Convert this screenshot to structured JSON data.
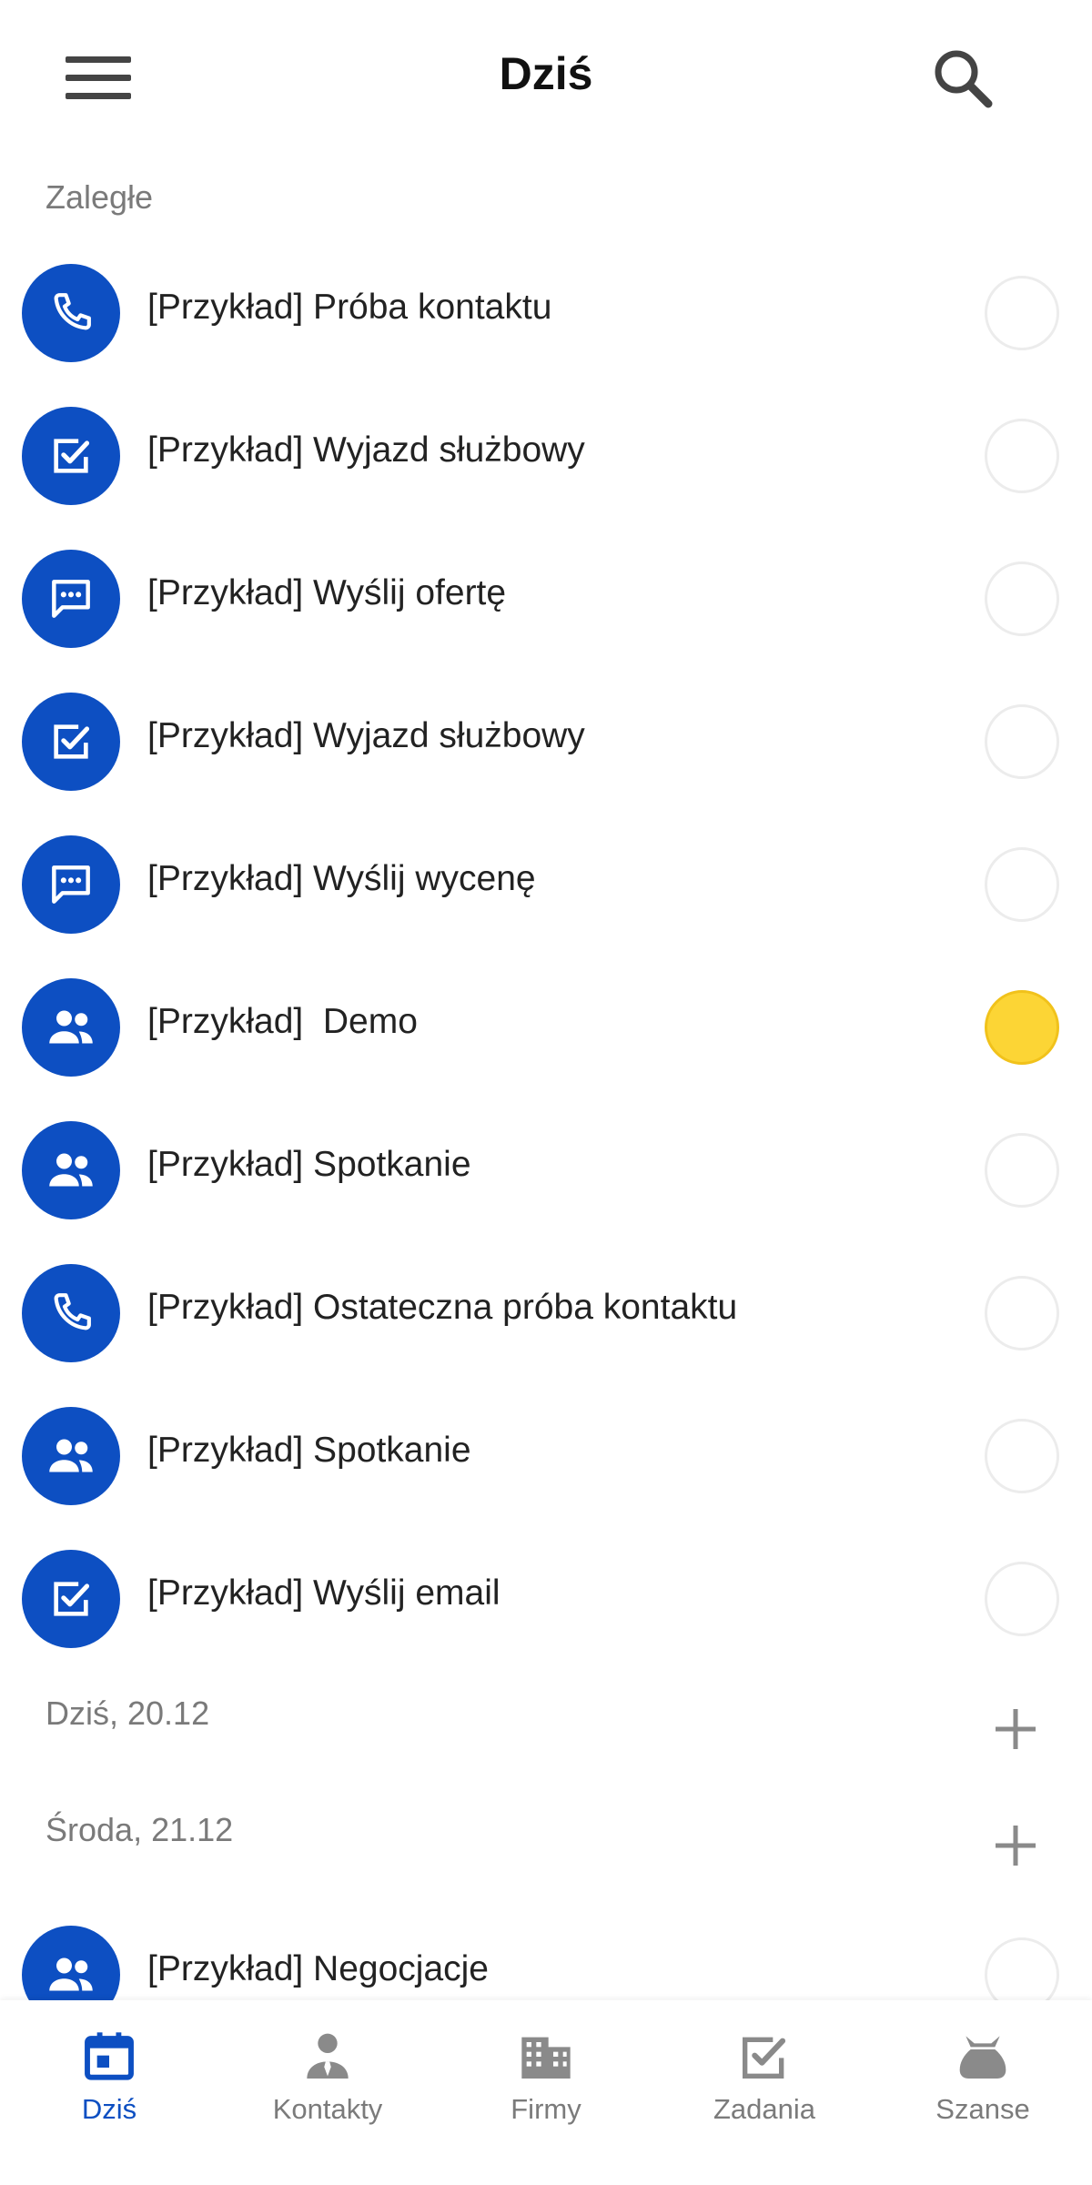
{
  "header": {
    "title": "Dziś"
  },
  "sections": [
    {
      "label": "Zaległe",
      "items": [
        {
          "icon": "phone-icon",
          "text": "[Przykład] Próba kontaktu",
          "done": false
        },
        {
          "icon": "task-check-icon",
          "text": "[Przykład] Wyjazd służbowy",
          "done": false
        },
        {
          "icon": "chat-icon",
          "text": "[Przykład] Wyślij ofertę",
          "done": false
        },
        {
          "icon": "task-check-icon",
          "text": "[Przykład] Wyjazd służbowy",
          "done": false
        },
        {
          "icon": "chat-icon",
          "text": "[Przykład] Wyślij wycenę",
          "done": false
        },
        {
          "icon": "people-icon",
          "text": "[Przykład]  Demo",
          "done": false,
          "highlighted": true
        },
        {
          "icon": "people-icon",
          "text": "[Przykład] Spotkanie",
          "done": false
        },
        {
          "icon": "phone-icon",
          "text": "[Przykład] Ostateczna próba kontaktu",
          "done": false
        },
        {
          "icon": "people-icon",
          "text": "[Przykład] Spotkanie",
          "done": false
        },
        {
          "icon": "task-check-icon",
          "text": "[Przykład] Wyślij email",
          "done": false
        }
      ]
    },
    {
      "label": "Dziś, 20.12",
      "add_icon": "plus-icon",
      "items": []
    },
    {
      "label": "Środa, 21.12",
      "add_icon": "plus-icon",
      "items": [
        {
          "icon": "people-icon",
          "text": "[Przykład] Negocjacje",
          "done": false
        }
      ]
    }
  ],
  "tabs": [
    {
      "label": "Dziś",
      "icon": "calendar-icon",
      "active": true
    },
    {
      "label": "Kontakty",
      "icon": "person-icon",
      "active": false
    },
    {
      "label": "Firmy",
      "icon": "building-icon",
      "active": false
    },
    {
      "label": "Zadania",
      "icon": "task-check-icon",
      "active": false
    },
    {
      "label": "Szanse",
      "icon": "money-bag-icon",
      "active": false
    }
  ],
  "colors": {
    "accent": "#0d4fc2",
    "highlight": "#fcd535",
    "muted_text": "#7a7a7a"
  }
}
